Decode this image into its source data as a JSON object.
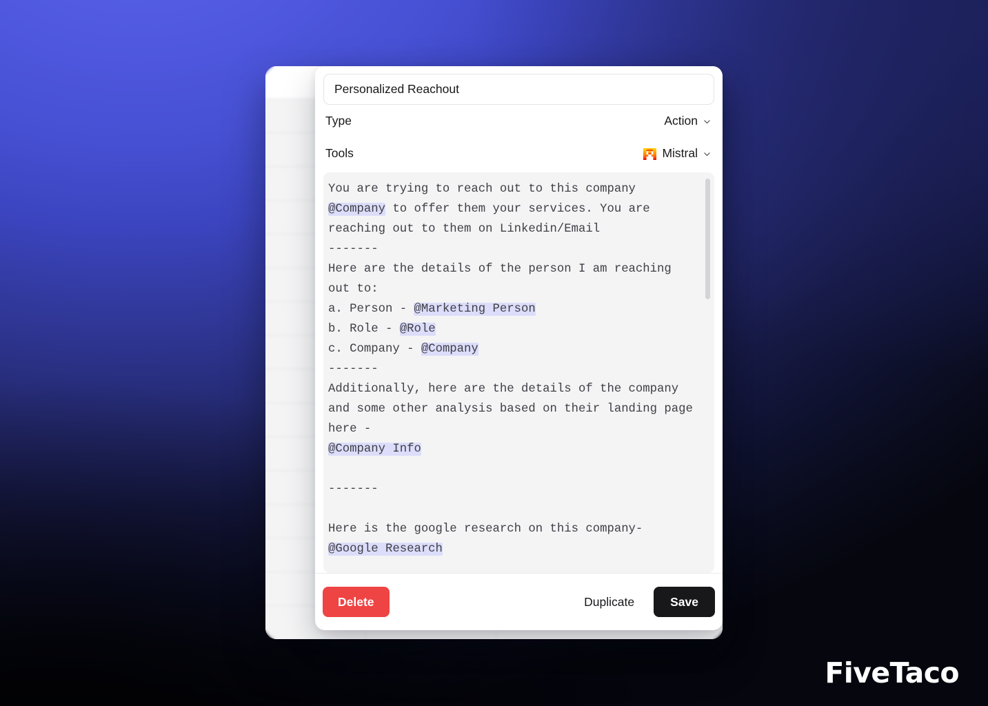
{
  "background": {
    "gradient_from": "#5a63e8",
    "gradient_to": "#05060e",
    "watermark": "FiveTaco"
  },
  "app_card": {
    "name": "blurred-spreadsheet-background",
    "row_line_color": "#e3e3e6",
    "row_count": 16,
    "row_spacing": 49
  },
  "modal": {
    "title_input": {
      "value": "Personalized Reachout",
      "placeholder": "Name"
    },
    "properties": [
      {
        "label": "Type",
        "value": "Action",
        "icon": "",
        "chevron": "chevron-down-icon"
      },
      {
        "label": "Tools",
        "value": "Mistral",
        "icon": "mistral-logo-icon",
        "chevron": "chevron-down-icon"
      }
    ],
    "prompt": {
      "segments": [
        {
          "text": "You are trying to reach out to this company\n",
          "token": false
        },
        {
          "text": "@Company",
          "token": true
        },
        {
          "text": " to offer them your services. You are reaching out to them on Linkedin/Email\n-------\nHere are the details of the person I am reaching out to:\na. Person - ",
          "token": false
        },
        {
          "text": "@Marketing Person",
          "token": true
        },
        {
          "text": "\nb. Role - ",
          "token": false
        },
        {
          "text": "@Role",
          "token": true
        },
        {
          "text": "\nc. Company - ",
          "token": false
        },
        {
          "text": "@Company",
          "token": true
        },
        {
          "text": "\n-------\nAdditionally, here are the details of the company and some other analysis based on their landing page here -\n",
          "token": false
        },
        {
          "text": "@Company Info",
          "token": true
        },
        {
          "text": "\n\n-------\n\nHere is the google research on this company-\n",
          "token": false
        },
        {
          "text": "@Google Research",
          "token": true
        }
      ],
      "highlight_color": "#dcddfa",
      "background_color": "#f4f4f5"
    },
    "footer": {
      "delete_label": "Delete",
      "duplicate_label": "Duplicate",
      "save_label": "Save",
      "delete_color": "#ef4444",
      "save_color": "#18181b"
    }
  }
}
